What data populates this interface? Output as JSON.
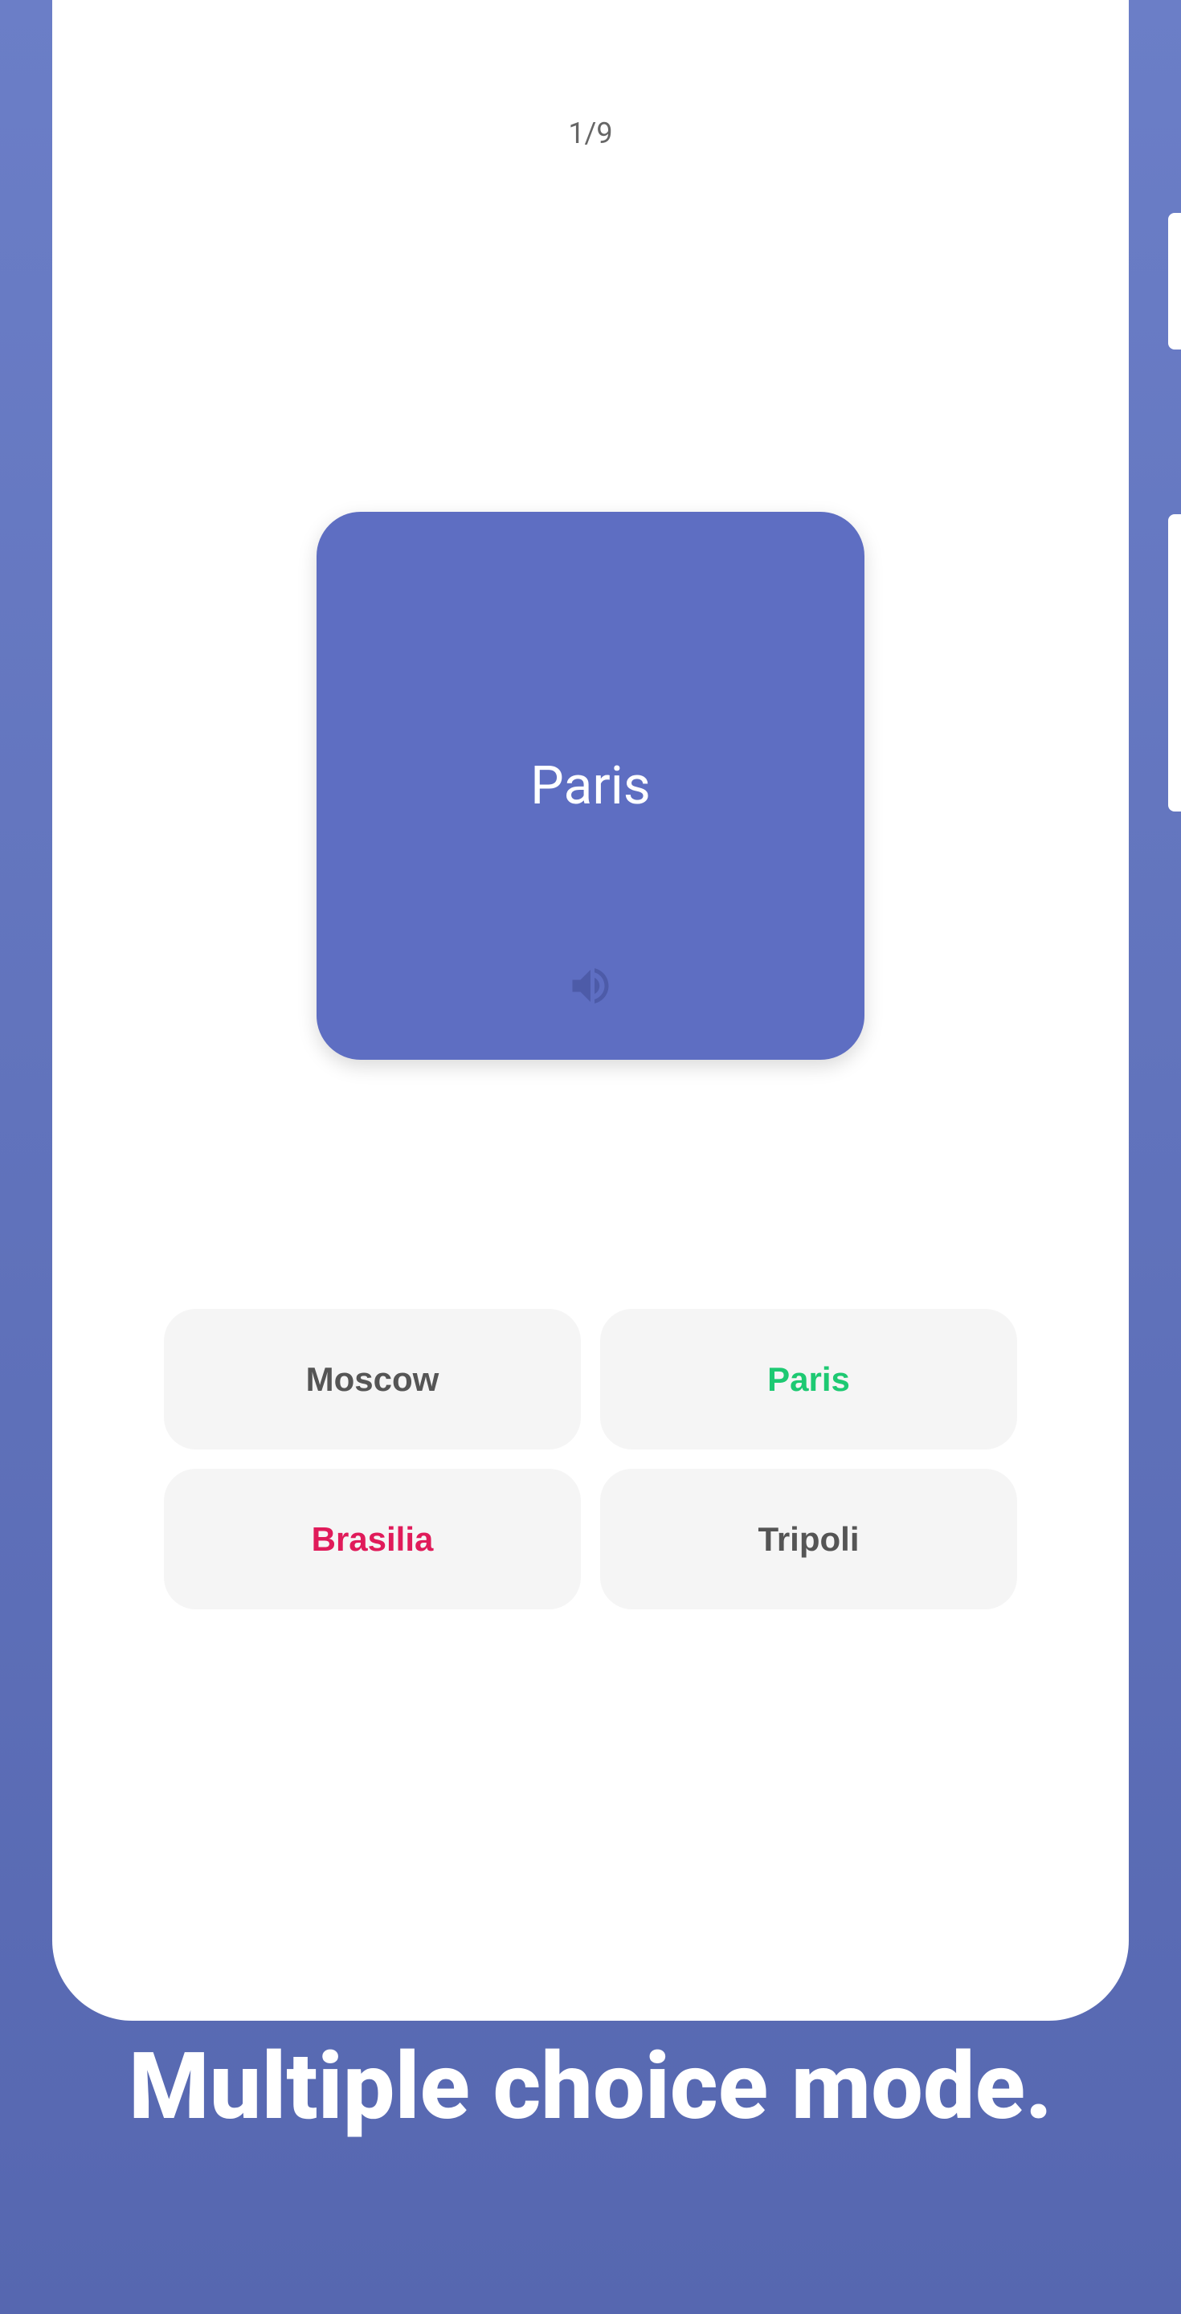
{
  "progress": {
    "text": "1/9"
  },
  "question": {
    "text": "Paris"
  },
  "answers": [
    {
      "label": "Moscow",
      "state": "neutral"
    },
    {
      "label": "Paris",
      "state": "correct"
    },
    {
      "label": "Brasilia",
      "state": "incorrect"
    },
    {
      "label": "Tripoli",
      "state": "neutral"
    }
  ],
  "caption": "Multiple choice mode."
}
